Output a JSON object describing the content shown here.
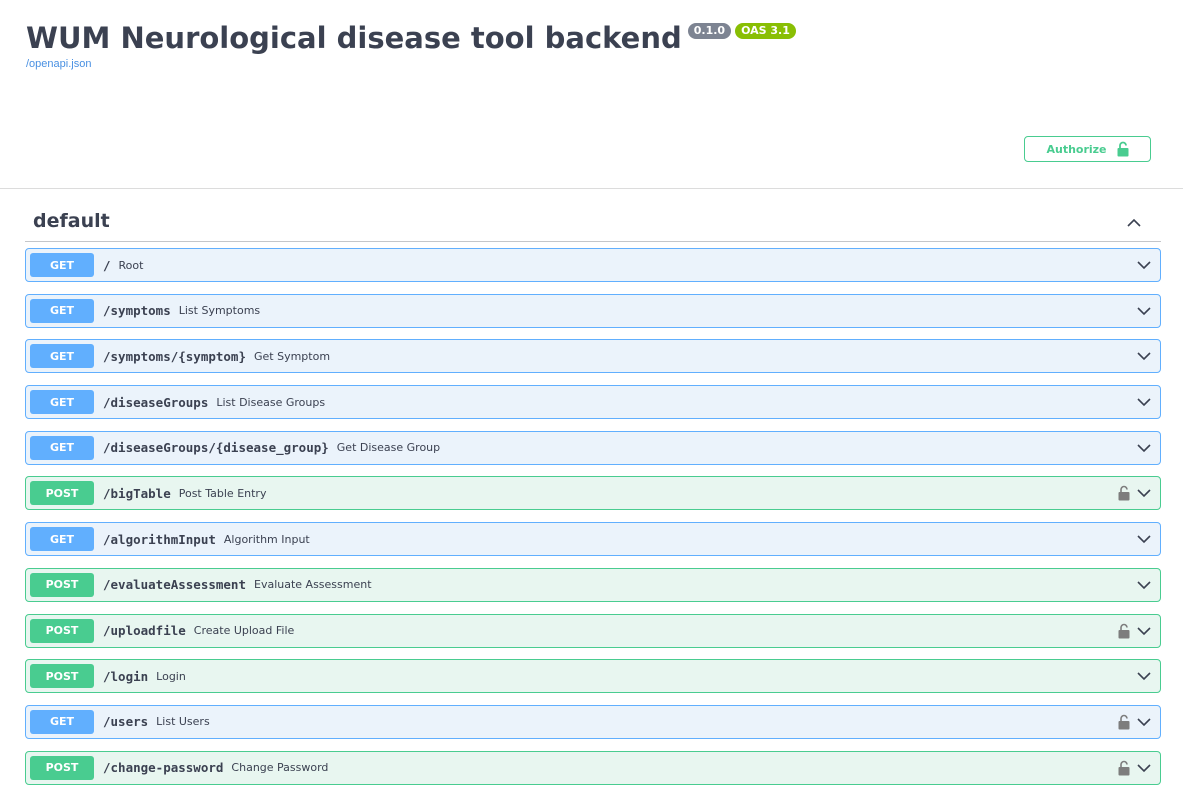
{
  "info": {
    "title": "WUM Neurological disease tool backend",
    "version": "0.1.0",
    "oas": "OAS 3.1",
    "spec_link": "/openapi.json"
  },
  "authorize": {
    "label": "Authorize",
    "icon": "lock-open-icon"
  },
  "tag": {
    "name": "default",
    "toggle_icon": "chevron-up-icon"
  },
  "colors": {
    "get": "#61affe",
    "post": "#49cc90",
    "get_bg": "#ebf3fb",
    "post_bg": "#e8f6f0"
  },
  "operations": [
    {
      "method": "GET",
      "path": "/",
      "summary": "Root",
      "locked": false
    },
    {
      "method": "GET",
      "path": "/symptoms",
      "summary": "List Symptoms",
      "locked": false
    },
    {
      "method": "GET",
      "path": "/symptoms/{symptom}",
      "summary": "Get Symptom",
      "locked": false
    },
    {
      "method": "GET",
      "path": "/diseaseGroups",
      "summary": "List Disease Groups",
      "locked": false
    },
    {
      "method": "GET",
      "path": "/diseaseGroups/{disease_group}",
      "summary": "Get Disease Group",
      "locked": false
    },
    {
      "method": "POST",
      "path": "/bigTable",
      "summary": "Post Table Entry",
      "locked": true
    },
    {
      "method": "GET",
      "path": "/algorithmInput",
      "summary": "Algorithm Input",
      "locked": false
    },
    {
      "method": "POST",
      "path": "/evaluateAssessment",
      "summary": "Evaluate Assessment",
      "locked": false
    },
    {
      "method": "POST",
      "path": "/uploadfile",
      "summary": "Create Upload File",
      "locked": true
    },
    {
      "method": "POST",
      "path": "/login",
      "summary": "Login",
      "locked": false
    },
    {
      "method": "GET",
      "path": "/users",
      "summary": "List Users",
      "locked": true
    },
    {
      "method": "POST",
      "path": "/change-password",
      "summary": "Change Password",
      "locked": true
    }
  ]
}
